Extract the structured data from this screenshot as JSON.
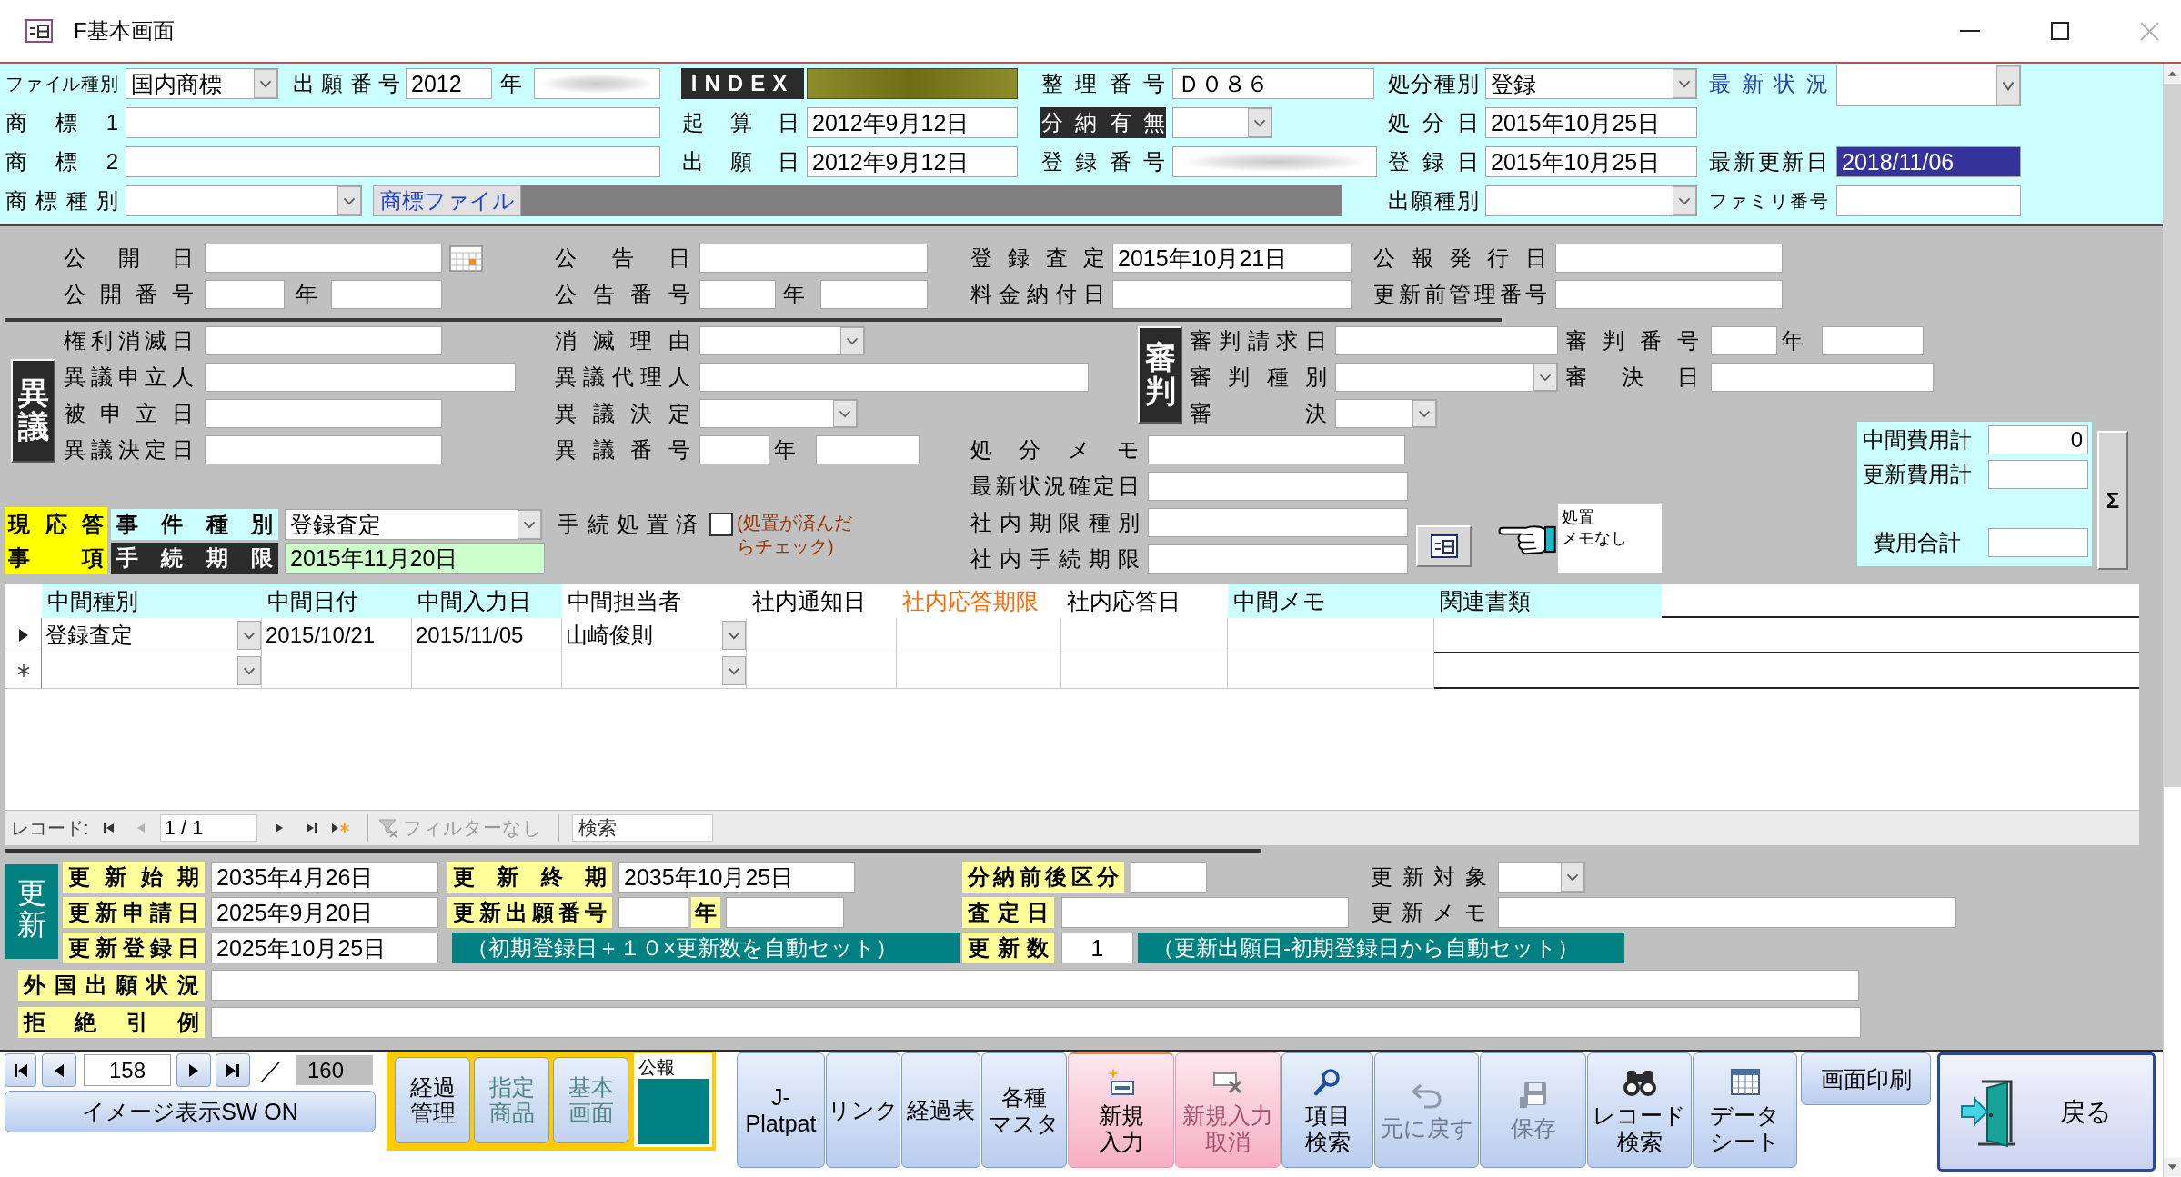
{
  "window": {
    "title": "F基本画面"
  },
  "header": {
    "fields": [
      {
        "label": "ファイル種別",
        "kind": "combo",
        "value": "国内商標"
      },
      {
        "label": "出願番号",
        "kind": "field",
        "value": "2012"
      },
      {
        "label": "年",
        "kind": "masked",
        "highlighted": false
      },
      {
        "label": {
          "text": "INDEX",
          "kind": "dark"
        },
        "kind": "masked",
        "highlighted": true
      },
      {
        "label": "整理番号",
        "kind": "field",
        "value": "Ｄ０８６"
      },
      {
        "label": "処分種別",
        "kind": "combo",
        "value": "登録"
      },
      {
        "label": {
          "text": "最新状況",
          "kind": "link"
        },
        "kind": "combo"
      },
      {
        "label": "商標1",
        "kind": "field"
      },
      {
        "label": "起算日",
        "kind": "field",
        "value": "2012年9月12日"
      },
      {
        "label": {
          "text": "分納有無",
          "kind": "dark"
        },
        "kind": "combo"
      },
      {
        "label": "処分日",
        "kind": "field",
        "value": "2015年10月25日"
      },
      {
        "label": "商標2",
        "kind": "field"
      },
      {
        "label": "出願日",
        "kind": "field",
        "value": "2012年9月12日"
      },
      {
        "label": "登録番号",
        "kind": "masked",
        "highlighted": false
      },
      {
        "label": "登録日",
        "kind": "field",
        "value": "2015年10月25日"
      },
      {
        "label": "最新更新日",
        "kind": "field",
        "value": "2018/11/06",
        "highlighted": true
      },
      {
        "label": "商標種別",
        "kind": "combo"
      },
      {
        "kind": "button",
        "text": "商標ファイル"
      },
      {
        "kind": "bar"
      },
      {
        "label": "出願種別",
        "kind": "combo"
      },
      {
        "label": "ファミリ番号",
        "kind": "field"
      }
    ]
  },
  "publication": {
    "fields": [
      {
        "label": "公開日",
        "kind": "field",
        "date_picker": true
      },
      {
        "label": "公告日",
        "kind": "field"
      },
      {
        "label": "登録査定",
        "kind": "field",
        "value": "2015年10月21日"
      },
      {
        "label": "公報発行日",
        "kind": "field"
      },
      {
        "label": "公開番号",
        "kind": "field"
      },
      {
        "label": "年",
        "kind": "field"
      },
      {
        "label": "公告番号",
        "kind": "field"
      },
      {
        "label": "年",
        "kind": "field"
      },
      {
        "label": "料金納付日",
        "kind": "field"
      },
      {
        "label": "更新前管理番号",
        "kind": "field"
      }
    ]
  },
  "opposition": {
    "label": "異議",
    "fields": [
      {
        "label": "権利消滅日",
        "kind": "field"
      },
      {
        "label": "消滅理由",
        "kind": "combo"
      },
      {
        "label": "異議申立人",
        "kind": "field"
      },
      {
        "label": "異議代理人",
        "kind": "field"
      },
      {
        "label": "被申立日",
        "kind": "field"
      },
      {
        "label": "異議決定",
        "kind": "combo"
      },
      {
        "label": "異議決定日",
        "kind": "field"
      },
      {
        "label": "異議番号",
        "kind": "field"
      },
      {
        "label": "年",
        "kind": "field"
      }
    ]
  },
  "trial": {
    "label": "審判",
    "fields": [
      {
        "label": "審判請求日",
        "kind": "field"
      },
      {
        "label": "審判番号",
        "kind": "field"
      },
      {
        "label": "年",
        "kind": "field"
      },
      {
        "label": "審判種別",
        "kind": "combo"
      },
      {
        "label": "審決日",
        "kind": "field"
      },
      {
        "label": "審決",
        "kind": "combo"
      }
    ]
  },
  "disposition": {
    "fields": [
      {
        "label": "処分メモ",
        "kind": "field"
      },
      {
        "label": "最新状況確定日",
        "kind": "field"
      },
      {
        "label": "社内期限種別",
        "kind": "field"
      },
      {
        "label": "社内手続期限",
        "kind": "field"
      }
    ]
  },
  "response": {
    "labels": [
      "現応答",
      "事項"
    ],
    "case_type": {
      "label": "事件種別",
      "value": "登録査定"
    },
    "deadline": {
      "label": "手続期限",
      "value": "2015年11月20日"
    },
    "done": {
      "label": "手続処置済",
      "checked": false,
      "hint": "(処置が済んだらチェック)"
    }
  },
  "memo": {
    "text": "処置メモなし"
  },
  "costs": {
    "fields": [
      {
        "label": "中間費用計",
        "value": "0"
      },
      {
        "label": "更新費用計"
      },
      {
        "label": "費用合計"
      }
    ],
    "sum_button": "Σ"
  },
  "interim": {
    "columns": [
      {
        "label": "中間種別",
        "highlighted": true,
        "emphasized": false
      },
      {
        "label": "中間日付",
        "highlighted": true,
        "emphasized": false
      },
      {
        "label": "中間入力日",
        "highlighted": true,
        "emphasized": false
      },
      {
        "label": "中間担当者",
        "highlighted": false,
        "emphasized": false
      },
      {
        "label": "社内通知日",
        "highlighted": false,
        "emphasized": false
      },
      {
        "label": "社内応答期限",
        "highlighted": false,
        "emphasized": true
      },
      {
        "label": "社内応答日",
        "highlighted": false,
        "emphasized": false
      },
      {
        "label": "中間メモ",
        "highlighted": true,
        "emphasized": false
      },
      {
        "label": "関連書類",
        "highlighted": true,
        "emphasized": false
      }
    ],
    "rows": [
      {
        "kind": "current",
        "cells": [
          "登録査定",
          "2015/10/21",
          "2015/11/05",
          "山崎俊則"
        ]
      },
      {
        "kind": "new"
      }
    ]
  },
  "record_nav": {
    "label": "レコード:",
    "position": "1 / 1",
    "filter": "フィルターなし",
    "search": {
      "placeholder": "検索"
    }
  },
  "renewal": {
    "label": "更新",
    "fields": [
      {
        "label": {
          "text": "更新始期",
          "kind": "yellow"
        },
        "kind": "field",
        "value": "2035年4月26日"
      },
      {
        "label": {
          "text": "更新終期",
          "kind": "yellow"
        },
        "kind": "field",
        "value": "2035年10月25日"
      },
      {
        "label": {
          "text": "分納前後区分",
          "kind": "yellow"
        },
        "kind": "field"
      },
      {
        "label": "更新対象",
        "kind": "combo"
      },
      {
        "label": {
          "text": "更新申請日",
          "kind": "yellow"
        },
        "kind": "field",
        "value": "2025年9月20日"
      },
      {
        "label": {
          "text": "更新出願番号",
          "kind": "yellow"
        },
        "kind": "field"
      },
      {
        "label": {
          "text": "年",
          "kind": "yellow"
        },
        "kind": "field"
      },
      {
        "label": {
          "text": "査定日",
          "kind": "yellow"
        },
        "kind": "field"
      },
      {
        "label": "更新メモ",
        "kind": "field"
      },
      {
        "label": {
          "text": "更新登録日",
          "kind": "yellow"
        },
        "kind": "field",
        "value": "2025年10月25日"
      },
      {
        "kind": "note",
        "text": "（初期登録日＋１０×更新数を自動セット）"
      },
      {
        "label": {
          "text": "更新数",
          "kind": "yellow"
        },
        "kind": "field",
        "value": "1"
      },
      {
        "kind": "note",
        "text": "（更新出願日-初期登録日から自動セット）"
      },
      {
        "label": {
          "text": "外国出願状況",
          "kind": "yellow"
        },
        "kind": "field"
      },
      {
        "label": {
          "text": "拒絶引例",
          "kind": "yellow"
        },
        "kind": "field"
      }
    ]
  },
  "bottom": {
    "record_nav": {
      "current": "158",
      "separator": "／",
      "total": "160"
    },
    "image_toggle": "イメージ表示SW ON",
    "group": [
      {
        "label": "経過管理",
        "disabled": false
      },
      {
        "label": "指定商品",
        "disabled": true
      },
      {
        "label": "基本画面",
        "disabled": true
      }
    ],
    "gazette": {
      "label": "公報"
    },
    "toolbar": [
      {
        "label": "J-Platpat",
        "highlighted": false,
        "disabled": false
      },
      {
        "label": "リンク",
        "highlighted": false,
        "disabled": false
      },
      {
        "label": "経過表",
        "highlighted": false,
        "disabled": false
      },
      {
        "label": "各種マスタ",
        "highlighted": false,
        "disabled": false
      },
      {
        "label": "新規入力",
        "highlighted": true,
        "disabled": false
      },
      {
        "label": "新規入力取消",
        "highlighted": true,
        "disabled": true
      },
      {
        "label": "項目検索",
        "highlighted": false,
        "disabled": false
      },
      {
        "label": "元に戻す",
        "highlighted": false,
        "disabled": true
      },
      {
        "label": "保存",
        "highlighted": false,
        "disabled": true
      },
      {
        "label": "レコード検索",
        "highlighted": false,
        "disabled": false
      },
      {
        "label": "データシート",
        "highlighted": false,
        "disabled": false
      }
    ],
    "print": "画面印刷",
    "back": "戻る"
  }
}
